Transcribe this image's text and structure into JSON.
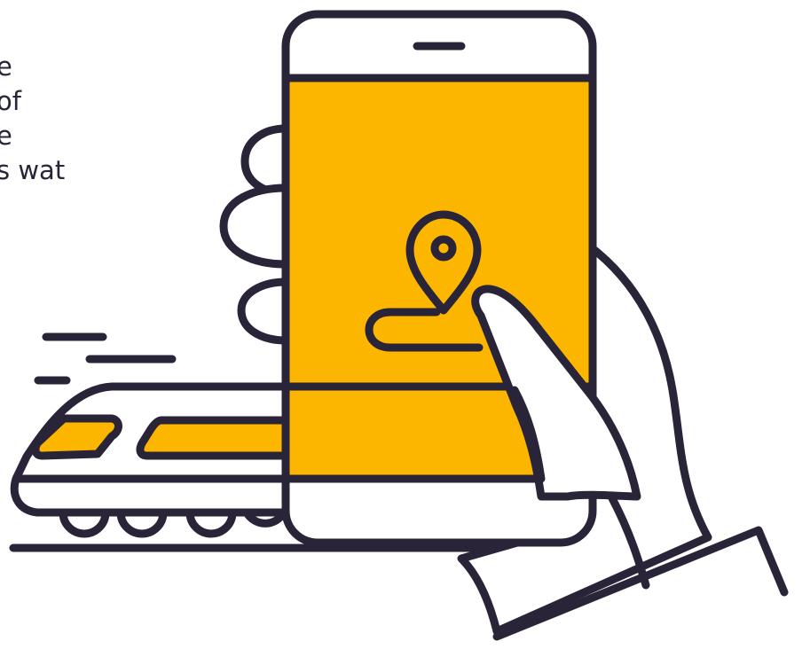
{
  "text": {
    "lines": [
      "e",
      "of",
      "e",
      "s wat"
    ]
  },
  "colors": {
    "ink": "#2a2438",
    "accent": "#fdb600",
    "background": "#ffffff"
  },
  "icons": {
    "illustration": "hand-holding-phone-with-map-pin-and-train"
  }
}
